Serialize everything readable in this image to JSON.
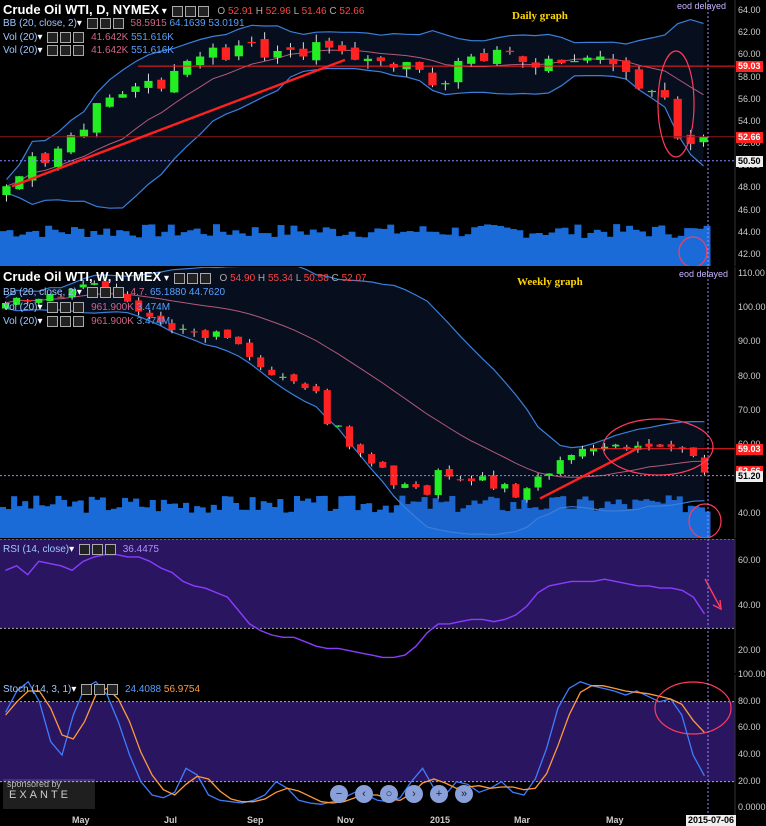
{
  "daily": {
    "title": "Crude Oil WTI, D, NYMEX",
    "label": "Daily graph",
    "ohlc": {
      "o_label": "O",
      "o": "52.91",
      "h_label": "H",
      "h": "52.96",
      "l_label": "L",
      "l": "51.46",
      "c_label": "C",
      "c": "52.66"
    },
    "bb": {
      "label": "BB (20, close, 2)",
      "v1": "58.5915",
      "v2": "64.1639",
      "v3": "53.0191"
    },
    "vol1": {
      "label": "Vol (20)",
      "v1": "41.642K",
      "v2": "551.616K"
    },
    "vol2": {
      "label": "Vol (20)",
      "v1": "41.642K",
      "v2": "551.616K"
    },
    "eod": "eod delayed",
    "price_tags": [
      "59.03",
      "52.66",
      "50.50"
    ],
    "yticks": [
      "64.00",
      "62.00",
      "60.00",
      "58.00",
      "56.00",
      "54.00",
      "52.00",
      "50.00",
      "48.00",
      "46.00",
      "44.00",
      "42.00"
    ]
  },
  "weekly": {
    "title": "Crude Oil WTI, W, NYMEX",
    "label": "Weekly graph",
    "ohlc": {
      "o_label": "O",
      "o": "54.90",
      "h_label": "H",
      "h": "55.34",
      "l_label": "L",
      "l": "50.58",
      "c_label": "C",
      "c": "52.07"
    },
    "bb": {
      "label": "BB (20, close, 2)",
      "v1": "4.7.",
      "v2": "65.1880",
      "v3": "44.7620"
    },
    "vol1": {
      "label": "Vol (20)",
      "v1": "961.900K",
      "v2": "3.474M"
    },
    "vol2": {
      "label": "Vol (20)",
      "v1": "961.900K",
      "v2": "3.474M"
    },
    "eod": "eod delayed",
    "price_tags": [
      "59.03",
      "52.66",
      "51.20"
    ],
    "yticks": [
      "110.00",
      "100.00",
      "90.00",
      "80.00",
      "70.00",
      "60.00",
      "50.00",
      "40.00"
    ]
  },
  "rsi": {
    "label": "RSI (14, close)",
    "value": "36.4475",
    "yticks": [
      "60.00",
      "40.00",
      "20.00"
    ]
  },
  "stoch": {
    "label": "Stoch (14, 3, 1)",
    "v1": "24.4088",
    "v2": "56.9754",
    "yticks": [
      "100.00",
      "80.00",
      "60.00",
      "40.00",
      "20.00",
      "0.0000"
    ]
  },
  "watermark": {
    "line1": "sponsored by",
    "line2": "EXANTE"
  },
  "controls": [
    "−",
    "‹",
    "○",
    "›",
    "+",
    "»"
  ],
  "x_labels": [
    "May",
    "Jul",
    "Sep",
    "Nov",
    "2015",
    "Mar",
    "May"
  ],
  "date_tag": "2015-07-06",
  "colors": {
    "up": "#22ee22",
    "down": "#ff2222",
    "bb": "#3b7fd9",
    "mid": "#b25a7a",
    "trend": "#ff2020",
    "rsi_bg": "#2a1660",
    "stoch_bg": "#2a1660",
    "vol": "#1a6bd8",
    "annot": "#ff3b5c"
  },
  "chart_data": [
    {
      "type": "candlestick",
      "title": "Crude Oil WTI, D, NYMEX",
      "ylim": [
        41,
        65
      ],
      "x_range": [
        "2015-04-06",
        "2015-07-06"
      ],
      "closes": [
        48.2,
        49.1,
        50.9,
        50.3,
        51.6,
        52.8,
        53.3,
        55.7,
        56.2,
        56.5,
        57.2,
        57.7,
        57.0,
        58.6,
        59.5,
        59.9,
        60.7,
        59.6,
        60.9,
        61.1,
        59.8,
        60.4,
        60.5,
        59.9,
        61.2,
        60.7,
        60.4,
        59.6,
        59.7,
        59.5,
        58.9,
        59.4,
        58.7,
        57.3,
        57.5,
        59.5,
        59.9,
        59.5,
        60.5,
        60.3,
        59.4,
        58.9,
        59.7,
        59.3,
        59.5,
        59.8,
        59.9,
        59.2,
        58.5,
        57.0,
        56.8,
        56.2,
        52.5,
        52.0,
        52.66
      ],
      "annotations": [
        "59.03",
        "52.66",
        "50.50"
      ]
    },
    {
      "type": "candlestick",
      "title": "Crude Oil WTI, W, NYMEX",
      "ylim": [
        33,
        112
      ],
      "x_range": [
        "2014-04-07",
        "2015-07-06"
      ],
      "closes": [
        101.5,
        103.0,
        101.9,
        102.7,
        104.1,
        103.3,
        105.6,
        106.9,
        107.3,
        105.9,
        104.0,
        101.9,
        99.0,
        97.5,
        95.9,
        93.6,
        94.0,
        92.9,
        91.3,
        93.2,
        91.3,
        89.5,
        85.8,
        82.8,
        80.5,
        80.0,
        78.7,
        76.7,
        75.8,
        66.2,
        65.8,
        59.6,
        57.8,
        54.7,
        53.5,
        48.4,
        48.7,
        47.8,
        45.6,
        52.8,
        50.9,
        49.8,
        49.6,
        51.0,
        47.4,
        48.7,
        44.8,
        47.5,
        50.9,
        51.8,
        55.7,
        57.2,
        59.0,
        59.2,
        59.6,
        60.2,
        58.9,
        59.9,
        59.6,
        59.6,
        59.6,
        59.1,
        56.9,
        52.07
      ],
      "annotations": [
        "59.03",
        "52.66",
        "51.20"
      ]
    },
    {
      "type": "line",
      "title": "RSI (14, close)",
      "ylim": [
        10,
        70
      ],
      "values": [
        56,
        58,
        54,
        60,
        59,
        58,
        56,
        60,
        62,
        63,
        63,
        62,
        62,
        60,
        57,
        55,
        51,
        49,
        48,
        46,
        44,
        38,
        32,
        29,
        27,
        26,
        26,
        24,
        22,
        21,
        21,
        20,
        19,
        18,
        17,
        17,
        18,
        22,
        28,
        32,
        32,
        33,
        34,
        34,
        33,
        34,
        36,
        40,
        46,
        49,
        50,
        51,
        51,
        51,
        52,
        51,
        50,
        49,
        49,
        48,
        48,
        47,
        44,
        36.4475
      ]
    },
    {
      "type": "line",
      "title": "Stoch (14, 3, 1)",
      "ylim": [
        -5,
        100
      ],
      "series": [
        {
          "name": "K",
          "values": [
            72,
            88,
            95,
            80,
            50,
            40,
            70,
            90,
            95,
            85,
            65,
            40,
            20,
            10,
            8,
            12,
            30,
            25,
            10,
            6,
            5,
            4,
            6,
            10,
            20,
            15,
            6,
            4,
            3,
            5,
            8,
            12,
            10,
            6,
            5,
            8,
            20,
            30,
            15,
            10,
            20,
            18,
            12,
            15,
            20,
            12,
            10,
            22,
            45,
            75,
            90,
            95,
            92,
            90,
            88,
            85,
            88,
            84,
            80,
            82,
            70,
            40,
            24.4088
          ]
        },
        {
          "name": "D",
          "values": [
            70,
            80,
            88,
            88,
            75,
            55,
            52,
            65,
            85,
            90,
            82,
            65,
            42,
            25,
            14,
            10,
            18,
            24,
            22,
            13,
            7,
            5,
            5,
            7,
            12,
            15,
            13,
            9,
            5,
            4,
            5,
            8,
            10,
            10,
            7,
            6,
            11,
            19,
            22,
            19,
            15,
            16,
            17,
            15,
            16,
            16,
            14,
            15,
            26,
            47,
            70,
            87,
            92,
            92,
            90,
            88,
            87,
            86,
            84,
            82,
            78,
            66,
            56.9754
          ]
        }
      ]
    }
  ]
}
